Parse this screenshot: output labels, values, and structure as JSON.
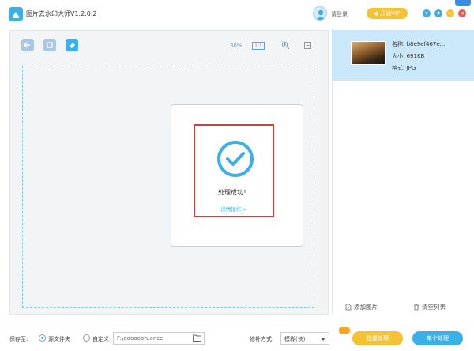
{
  "app": {
    "title": "图片去水印大师V1.2.0.2"
  },
  "header": {
    "login_label": "请登录",
    "vip_label": "开通VIP"
  },
  "toolbar": {
    "zoom_percent": "30%",
    "zoom_ratio": "1:1"
  },
  "result": {
    "message": "处理成功！",
    "detail_link": "详情操作 >"
  },
  "file": {
    "name": "名称: b8e9ef467e...",
    "size": "大小: 691KB",
    "format": "格式: JPG"
  },
  "right_actions": {
    "add_label": "添加图片",
    "clear_label": "清空列表"
  },
  "bottom": {
    "save_to_label": "保存至:",
    "source_folder_label": "源文件夹",
    "custom_label": "自定义",
    "path_value": "F:\\ddooooruance",
    "repair_label": "修补方式:",
    "repair_value": "模糊(快)",
    "batch_button": "批量处理",
    "single_button": "单个处理"
  },
  "colors": {
    "accent": "#3ab0e8",
    "vip": "#f5c233",
    "highlight": "#d93a3a"
  }
}
